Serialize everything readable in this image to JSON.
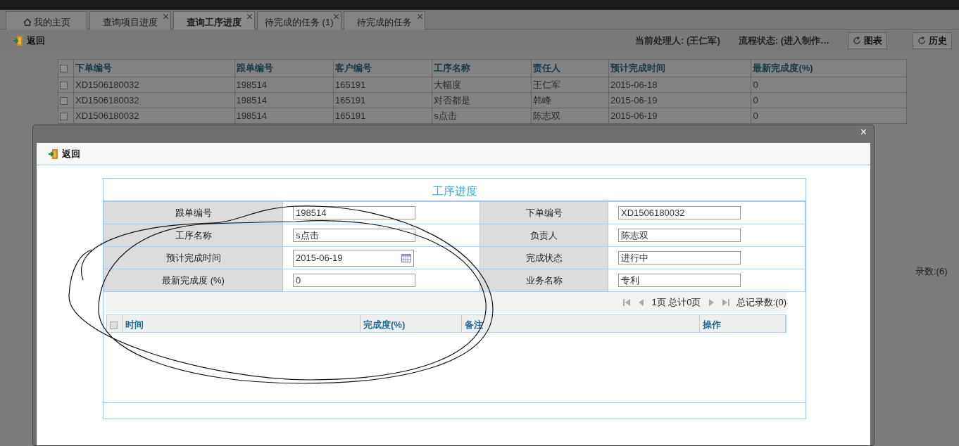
{
  "tabs": [
    {
      "label": "我的主页",
      "kind": "home",
      "selected": false
    },
    {
      "label": "查询项目进度",
      "kind": "closable",
      "selected": false
    },
    {
      "label": "查询工序进度",
      "kind": "closable",
      "selected": true
    },
    {
      "label": "待完成的任务 (1)",
      "kind": "closable",
      "selected": false
    },
    {
      "label": "待完成的任务",
      "kind": "closable",
      "selected": false
    }
  ],
  "toolbar": {
    "back_button": "返回",
    "handler": "当前处理人: (王仁军)",
    "flow_status": "流程状态: (进入制作…",
    "buttons": [
      "图表",
      "历史"
    ]
  },
  "grid": {
    "header_checked": false,
    "columns": [
      "下单编号",
      "跟单编号",
      "客户编号",
      "工序名称",
      "责任人",
      "预计完成时间",
      "最新完成度(%)"
    ],
    "rows": [
      {
        "checked": false,
        "cells": [
          "XD1506180032",
          "198514",
          "165191",
          "大幅度",
          "王仁军",
          "2015-06-18",
          "0"
        ]
      },
      {
        "checked": false,
        "cells": [
          "XD1506180032",
          "198514",
          "165191",
          "对否都是",
          "韩峰",
          "2015-06-19",
          "0"
        ]
      },
      {
        "checked": false,
        "cells": [
          "XD1506180032",
          "198514",
          "165191",
          "s点击",
          "陈志双",
          "2015-06-19",
          "0"
        ]
      }
    ]
  },
  "side_text": "录数:(6)",
  "dialog": {
    "close": "×",
    "back_button": "返回",
    "form": {
      "title": "工序进度",
      "rows": [
        [
          {
            "label": "跟单编号",
            "value": "198514",
            "kind": "text"
          },
          {
            "label": "下单编号",
            "value": "XD1506180032",
            "kind": "text"
          }
        ],
        [
          {
            "label": "工序名称",
            "value": "s点击",
            "kind": "text"
          },
          {
            "label": "负责人",
            "value": "陈志双",
            "kind": "text"
          }
        ],
        [
          {
            "label": "预计完成时间",
            "value": "2015-06-19",
            "kind": "date"
          },
          {
            "label": "完成状态",
            "value": "进行中",
            "kind": "text"
          }
        ],
        [
          {
            "label": "最新完成度 (%)",
            "value": "0",
            "kind": "text"
          },
          {
            "label": "业务名称",
            "value": "专利",
            "kind": "text"
          }
        ]
      ]
    },
    "pager": {
      "page": "1页 总计0页",
      "total": "总记录数:(0)"
    },
    "sub_grid": {
      "header_checked": false,
      "columns": [
        "时间",
        "完成度(%)",
        "备注",
        "操作"
      ]
    }
  }
}
